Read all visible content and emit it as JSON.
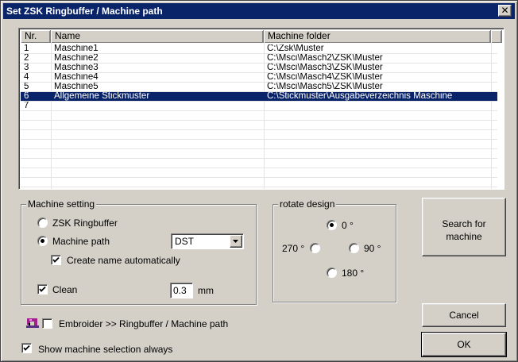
{
  "window": {
    "title": "Set ZSK Ringbuffer / Machine path",
    "close_glyph": "✕"
  },
  "table": {
    "columns": [
      "Nr.",
      "Name",
      "Machine folder"
    ],
    "rows": [
      {
        "nr": "1",
        "name": "Maschine1",
        "folder": "C:\\Zsk\\Muster"
      },
      {
        "nr": "2",
        "name": "Maschine2",
        "folder": "C:\\Msci\\Masch2\\ZSK\\Muster"
      },
      {
        "nr": "3",
        "name": "Maschine3",
        "folder": "C:\\Msci\\Masch3\\ZSK\\Muster"
      },
      {
        "nr": "4",
        "name": "Maschine4",
        "folder": "C:\\Msci\\Masch4\\ZSK\\Muster"
      },
      {
        "nr": "5",
        "name": "Maschine5",
        "folder": "C:\\Msci\\Masch5\\ZSK\\Muster"
      },
      {
        "nr": "6",
        "name": "Allgemeine Stickmuster",
        "folder": "C:\\Stickmuster\\Ausgabeverzeichnis Maschine"
      },
      {
        "nr": "7",
        "name": "",
        "folder": ""
      }
    ],
    "selected_row": "6"
  },
  "machine_setting": {
    "caption": "Machine setting",
    "zsk_ringbuffer_label": "ZSK Ringbuffer",
    "machine_path_label": "Machine path",
    "selected_option": "Machine path",
    "format_value": "DST",
    "create_name_label": "Create name automatically",
    "create_name_checked": true,
    "clean_label": "Clean",
    "clean_checked": true,
    "clean_value": "0.3",
    "clean_unit": "mm"
  },
  "rotate_design": {
    "caption": "rotate design",
    "options": {
      "deg0": "0 °",
      "deg90": "90 °",
      "deg180": "180 °",
      "deg270": "270 °"
    },
    "selected": "0 °"
  },
  "buttons": {
    "search": "Search for machine",
    "cancel": "Cancel",
    "ok": "OK"
  },
  "options": {
    "embroider_label": "Embroider >> Ringbuffer / Machine path",
    "embroider_checked": false,
    "show_selection_label": "Show machine selection always",
    "show_selection_checked": true
  },
  "colors": {
    "face": "#d4d0c8",
    "title_bar": "#0a246a",
    "selection": "#0a246a"
  },
  "icons": {
    "close": "close-icon",
    "machine": "sewing-machine-icon",
    "combo": "chevron-down-icon",
    "check": "checkmark-icon"
  }
}
